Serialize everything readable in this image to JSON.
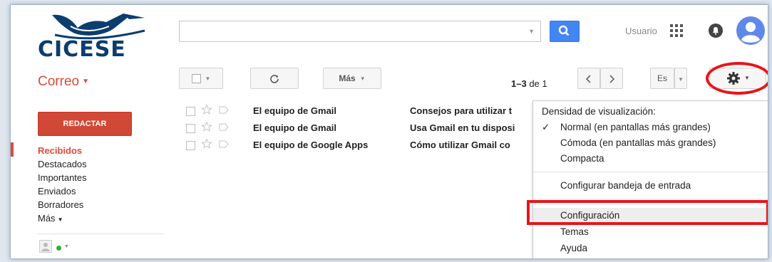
{
  "brand": {
    "logo_text": "CICESE"
  },
  "header": {
    "user_name": "Usuario"
  },
  "toolbar": {
    "app_title": "Correo",
    "more_label": "Más",
    "pager": {
      "range": "1–3",
      "of_label": "de",
      "total": "1"
    },
    "input_tools_label": "Es"
  },
  "sidebar": {
    "compose_label": "REDACTAR",
    "items": [
      {
        "label": "Recibidos",
        "active": true
      },
      {
        "label": "Destacados"
      },
      {
        "label": "Importantes"
      },
      {
        "label": "Enviados"
      },
      {
        "label": "Borradores"
      },
      {
        "label": "Más"
      }
    ]
  },
  "mails": [
    {
      "sender": "El equipo de Gmail",
      "subject": "Consejos para utilizar t"
    },
    {
      "sender": "El equipo de Gmail",
      "subject": "Usa Gmail en tu disposi"
    },
    {
      "sender": "El equipo de Google Apps",
      "subject": "Cómo utilizar Gmail co"
    }
  ],
  "settings_menu": {
    "header": "Densidad de visualización:",
    "density": [
      {
        "label": "Normal (en pantallas más grandes)",
        "checked": true
      },
      {
        "label": "Cómoda (en pantallas más grandes)"
      },
      {
        "label": "Compacta"
      }
    ],
    "inbox_config": "Configurar bandeja de entrada",
    "settings": "Configuración",
    "themes": "Temas",
    "help": "Ayuda"
  },
  "colors": {
    "accent_red": "#dd4b39",
    "search_blue": "#4285f4",
    "highlight_red": "#e8141a",
    "logo_blue": "#0b3d6f"
  },
  "icons": [
    "cicese-bird-logo",
    "search-icon",
    "apps-grid-icon",
    "notifications-icon",
    "avatar-icon",
    "refresh-icon",
    "gear-icon",
    "chevron-left-icon",
    "chevron-right-icon",
    "star-icon",
    "label-icon",
    "check-icon"
  ]
}
